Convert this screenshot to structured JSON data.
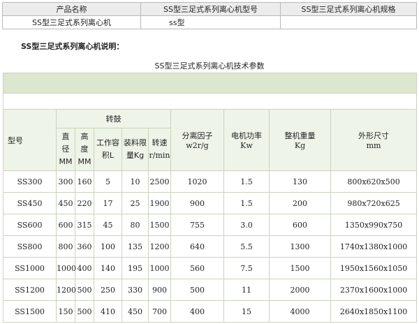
{
  "info": {
    "headers": [
      "产品名称",
      "SS型三足式系列离心机型号",
      "SS型三足式系列离心机规格"
    ],
    "values": [
      "SS型三足式系列离心机",
      "ss型",
      ""
    ]
  },
  "description_title": "SS型三足式系列离心机说明：",
  "spec": {
    "caption": "SS型三足式系列离心机技术参数",
    "group_header": "转鼓",
    "columns": {
      "model": "型号",
      "diameter": [
        "直",
        "径",
        "MM"
      ],
      "height": [
        "高",
        "度",
        "MM"
      ],
      "volume": [
        "工作容",
        "积L"
      ],
      "load": [
        "装料限",
        "量Kg"
      ],
      "speed": [
        "转速",
        "r/min"
      ],
      "factor": [
        "分离因子",
        "w2r/g"
      ],
      "power": [
        "电机功率",
        "Kw"
      ],
      "weight": [
        "整机重量",
        "Kg"
      ],
      "dims": [
        "外形尺寸",
        "mm"
      ]
    },
    "rows": [
      {
        "model": "SS300",
        "diameter": "300",
        "height": "160",
        "volume": "5",
        "load": "10",
        "speed": "2500",
        "factor": "1020",
        "power": "1.5",
        "weight": "130",
        "dims": "800x620x500"
      },
      {
        "model": "SS450",
        "diameter": "450",
        "height": "220",
        "volume": "17",
        "load": "25",
        "speed": "1900",
        "factor": "900",
        "power": "1.5",
        "weight": "200",
        "dims": "980x720x625"
      },
      {
        "model": "SS600",
        "diameter": "600",
        "height": "315",
        "volume": "45",
        "load": "80",
        "speed": "1500",
        "factor": "755",
        "power": "3.0",
        "weight": "600",
        "dims": "1350x990x750"
      },
      {
        "model": "SS800",
        "diameter": "800",
        "height": "360",
        "volume": "100",
        "load": "135",
        "speed": "1200",
        "factor": "640",
        "power": "5.5",
        "weight": "1300",
        "dims": "1740x1380x1000"
      },
      {
        "model": "SS1000",
        "diameter": "1000",
        "height": "400",
        "volume": "140",
        "load": "195",
        "speed": "1000",
        "factor": "560",
        "power": "7.5",
        "weight": "1500",
        "dims": "1950x1560x1050"
      },
      {
        "model": "SS1200",
        "diameter": "1200",
        "height": "500",
        "volume": "250",
        "load": "330",
        "speed": "900",
        "factor": "500",
        "power": "11",
        "weight": "2000",
        "dims": "2370x1600x1000"
      },
      {
        "model": "SS1500",
        "diameter": "150",
        "height": "500",
        "volume": "410",
        "load": "450",
        "speed": "700",
        "factor": "400",
        "power": "15",
        "weight": "4000",
        "dims": "2640x1850x1100"
      }
    ]
  }
}
